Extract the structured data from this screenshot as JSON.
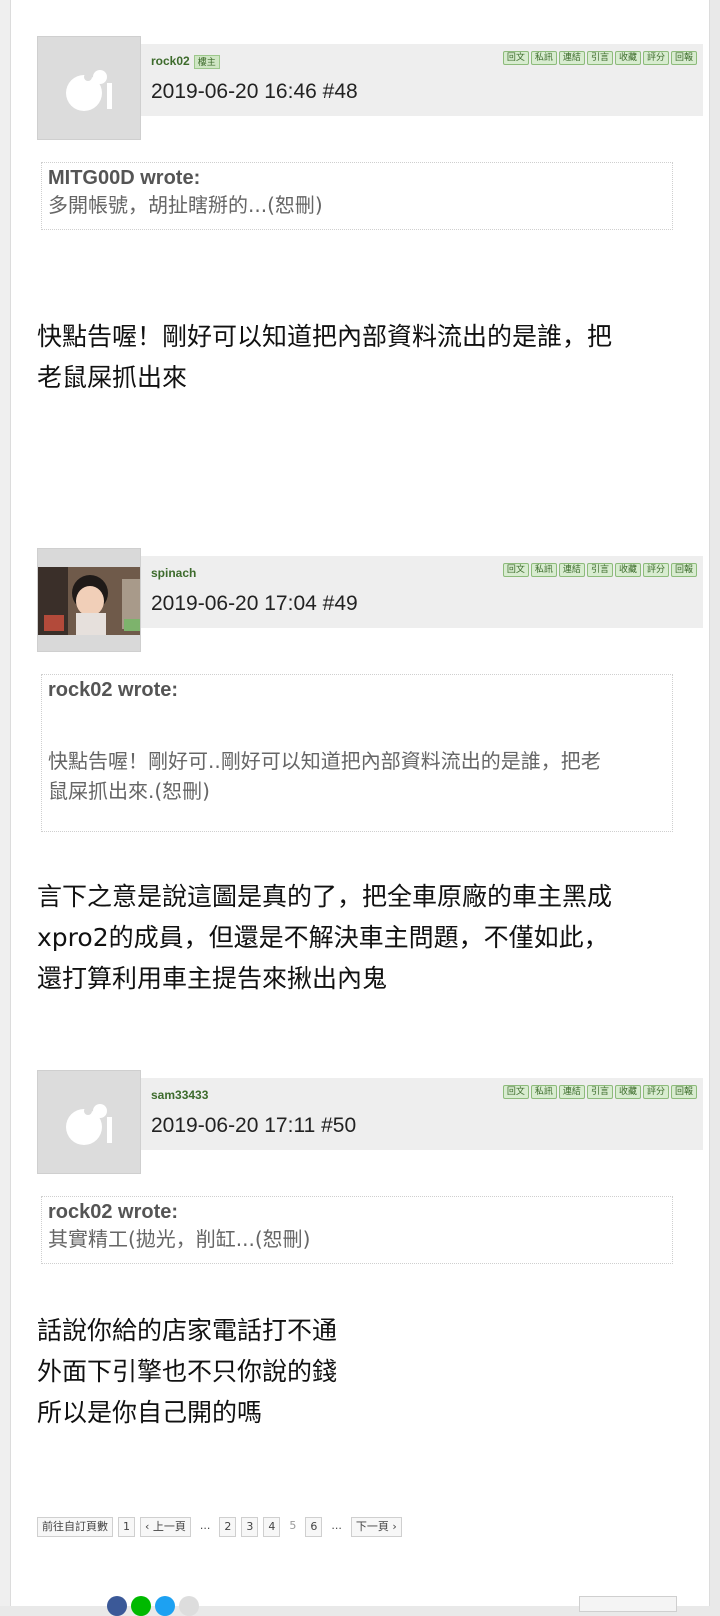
{
  "toolbar_labels": [
    "回文",
    "私訊",
    "連結",
    "引言",
    "收藏",
    "評分",
    "回報"
  ],
  "posts": [
    {
      "user": "rock02",
      "badge": "樓主",
      "timestamp": "2019-06-20 16:46  #48",
      "avatar": "default-avatar-icon",
      "quote_author": "MITG00D wrote:",
      "quote_text": "多開帳號，胡扯瞎掰的...(恕刪)",
      "body": "快點告喔！剛好可以知道把內部資料流出的是誰，把\n老鼠屎抓出來"
    },
    {
      "user": "spinach",
      "badge": "",
      "timestamp": "2019-06-20 17:04  #49",
      "avatar": "child-photo-avatar",
      "quote_author": "rock02 wrote:",
      "quote_text": "快點告喔！剛好可..剛好可以知道把內部資料流出的是誰，把老\n鼠屎抓出來.(恕刪)",
      "body": "言下之意是說這圖是真的了，把全車原廠的車主黑成\nxpro2的成員，但還是不解決車主問題，不僅如此，\n還打算利用車主提告來揪出內鬼"
    },
    {
      "user": "sam33433",
      "badge": "",
      "timestamp": "2019-06-20 17:11  #50",
      "avatar": "default-avatar-icon",
      "quote_author": "rock02 wrote:",
      "quote_text": "其實精工(拋光，削缸...(恕刪)",
      "body": "話說你給的店家電話打不通\n外面下引擎也不只你說的錢\n所以是你自己開的嗎"
    }
  ],
  "pagination": {
    "goto_label": "前往自訂頁數",
    "first": "1",
    "prev": "‹ 上一頁",
    "ellipsis": "...",
    "pages": [
      "2",
      "3",
      "4",
      "5",
      "6"
    ],
    "current": "5",
    "ellipsis2": "...",
    "next": "下一頁 ›"
  },
  "colors": {
    "username": "#3d6b2c",
    "tool_bg": "#d8ecd0",
    "header_bg": "#eeeeee",
    "share": [
      "#3b5998",
      "#00b900",
      "#1da1f2",
      "#dddddd"
    ]
  }
}
